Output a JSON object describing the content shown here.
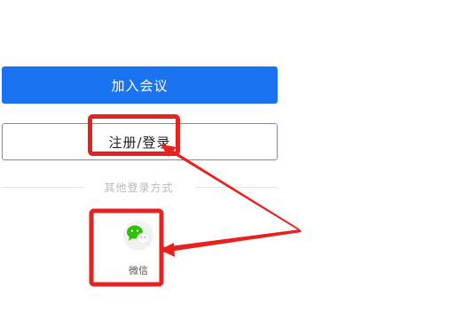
{
  "join_meeting_label": "加入会议",
  "register_login_label": "注册/登录",
  "other_login_label": "其他登录方式",
  "wechat_label": "微信",
  "colors": {
    "primary_blue": "#1a73f0",
    "annotation_red": "#e8211f",
    "wechat_green": "#2dc100"
  },
  "icons": [
    "wechat-icon"
  ]
}
